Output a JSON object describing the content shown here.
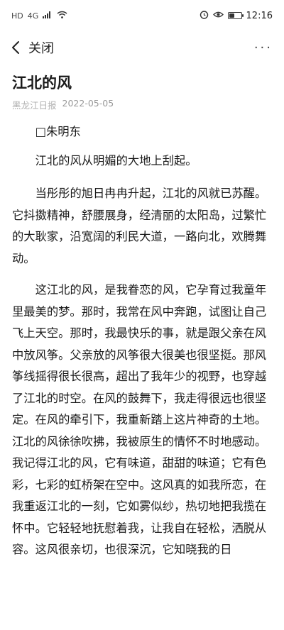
{
  "status_bar": {
    "network": "HD",
    "signal": "4G",
    "time": "12:16",
    "icons": [
      "alarm-icon",
      "eye-comfort-icon",
      "battery-icon"
    ],
    "battery_level": 0.45
  },
  "nav": {
    "close_label": "关闭",
    "more_label": "···"
  },
  "article": {
    "title": "江北的风",
    "source": "黑龙江日报",
    "date": "2022-05-05",
    "author_line": "□朱明东",
    "paragraphs": [
      "江北的风从明媚的大地上刮起。",
      "当彤彤的旭日冉冉升起，江北的风就已苏醒。它抖擞精神，舒腰展身，经清丽的太阳岛，过繁忙的大耿家，沿宽阔的利民大道，一路向北，欢腾舞动。",
      "这江北的风，是我眷恋的风，它孕育过我童年里最美的梦。那时，我常在风中奔跑，试图让自己飞上天空。那时，我最快乐的事，就是跟父亲在风中放风筝。父亲放的风筝很大很美也很坚挺。那风筝线摇得很长很高，超出了我年少的视野，也穿越了江北的时空。在风的鼓舞下，我走得很远也很坚定。在风的牵引下，我重新踏上这片神奇的土地。江北的风徐徐吹拂，我被原生的情怀不时地感动。我记得江北的风，它有味道，甜甜的味道；它有色彩，七彩的虹桥架在空中。这风真的如我所恋，在我重返江北的一刻，它如雾似纱，热切地把我揽在怀中。它轻轻地抚慰着我，让我自在轻松，洒脱从容。这风很亲切，也很深沉，它知晓我的日"
    ]
  }
}
